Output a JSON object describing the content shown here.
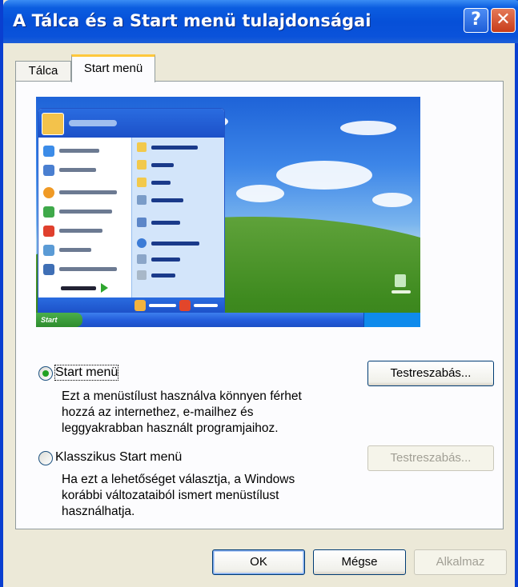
{
  "window": {
    "title": "A Tálca és a Start menü tulajdonságai",
    "help_glyph": "?",
    "close_glyph": "✕"
  },
  "tabs": [
    {
      "label": "Tálca",
      "selected": false
    },
    {
      "label": "Start menü",
      "selected": true
    }
  ],
  "preview": {
    "start_label": "Start"
  },
  "options": {
    "start_menu": {
      "label": "Start menü",
      "selected": true,
      "description": [
        "Ezt a menüstílust használva könnyen férhet",
        "hozzá az internethez, e-mailhez és",
        "leggyakrabban használt programjaihoz."
      ],
      "customize_label": "Testreszabás...",
      "customize_enabled": true
    },
    "classic_start_menu": {
      "label": "Klasszikus Start menü",
      "selected": false,
      "description": [
        "Ha ezt a lehetőséget választja, a Windows",
        "korábbi változataiból ismert menüstílust",
        "használhatja."
      ],
      "customize_label": "Testreszabás...",
      "customize_enabled": false
    }
  },
  "footer": {
    "ok_label": "OK",
    "cancel_label": "Mégse",
    "apply_label": "Alkalmaz",
    "apply_enabled": false
  },
  "colors": {
    "title_bar": "#0650D8",
    "window_bg": "#ECE9D8",
    "radio_dot": "#21A121",
    "close_button": "#C83C1A"
  }
}
